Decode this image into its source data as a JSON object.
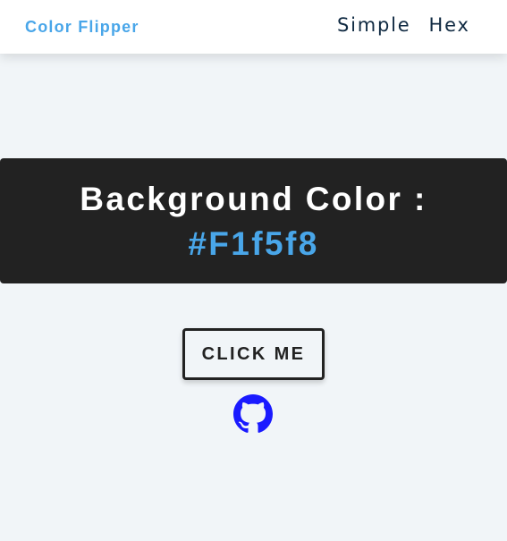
{
  "navbar": {
    "brand": "Color Flipper",
    "links": [
      {
        "label": "Simple"
      },
      {
        "label": "Hex"
      }
    ]
  },
  "banner": {
    "heading": "Background Color :",
    "color_value": "#F1f5f8"
  },
  "main": {
    "button_label": "CLICK ME",
    "github_icon": "github-icon"
  },
  "colors": {
    "page_background": "#f1f5f8",
    "accent": "#49a6e9",
    "banner_background": "#222222",
    "nav_text": "#102a42",
    "github_icon": "#1a1aff"
  }
}
